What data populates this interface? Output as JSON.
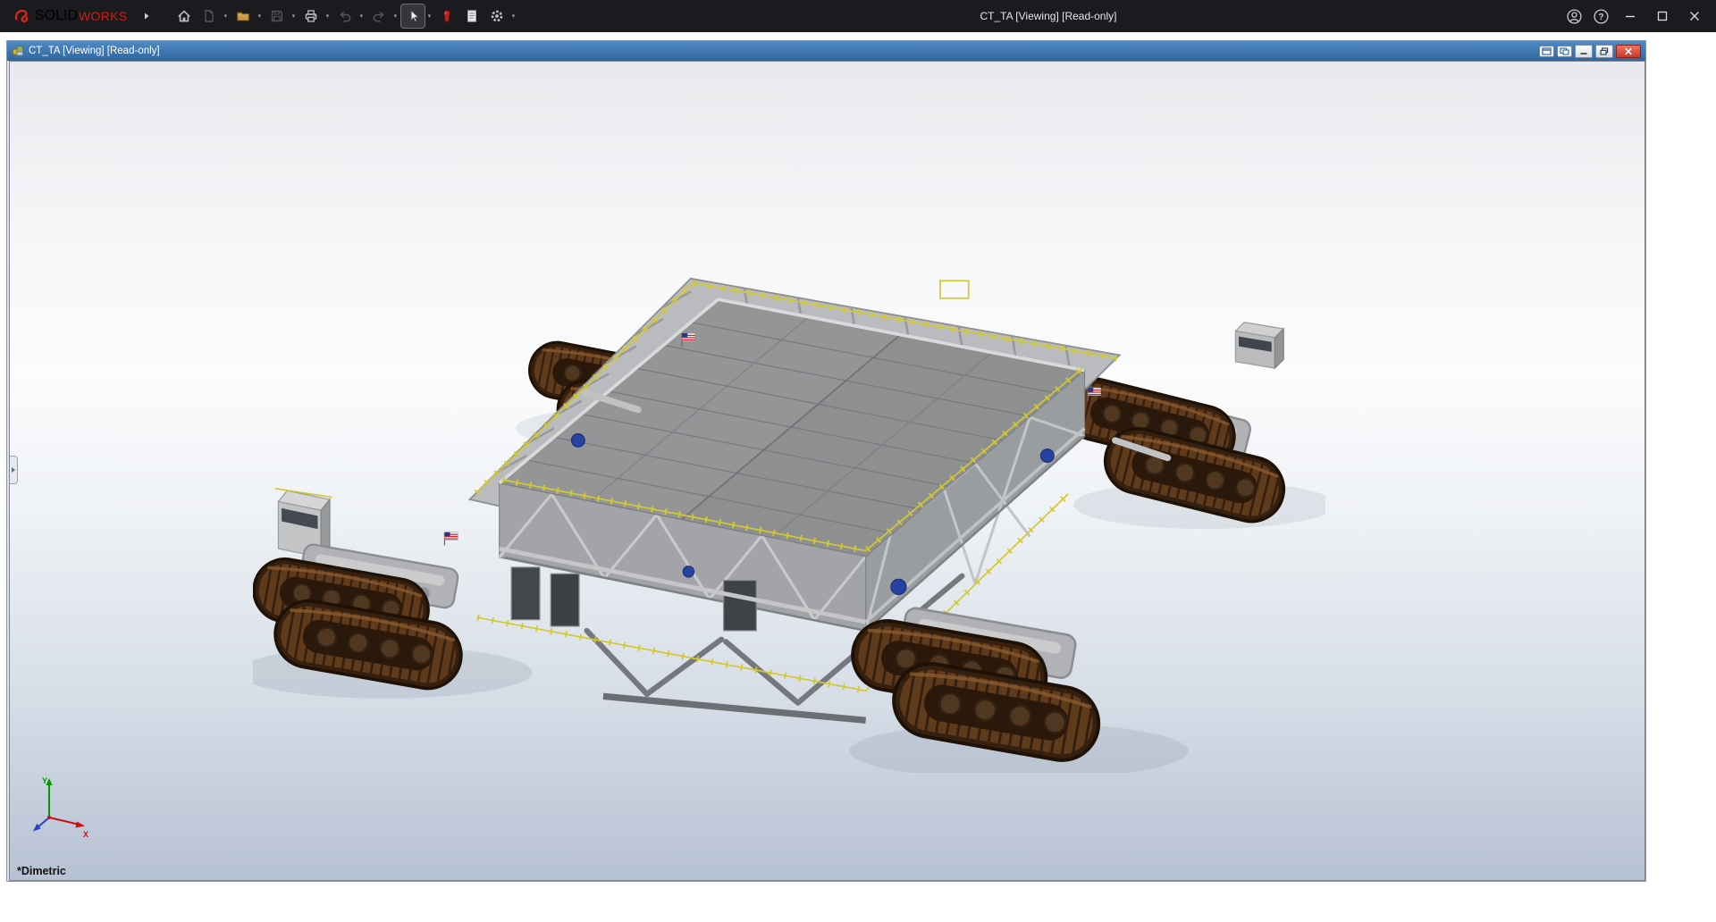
{
  "titlebar": {
    "brand": {
      "bold": "SOLID",
      "light": "WORKS"
    },
    "title": "CT_TA [Viewing] [Read-only]",
    "help_glyph": "?"
  },
  "document": {
    "title": "CT_TA [Viewing] [Read-only]"
  },
  "viewport": {
    "orientation": "*Dimetric",
    "triad": {
      "x": "X",
      "y": "Y"
    }
  },
  "icons": {
    "dassault-logo-icon": "red-swirl",
    "toolbar-expand-icon": "chevron-right",
    "home-icon": "house",
    "new-document-icon": "blank-page (disabled)",
    "open-icon": "yellow-folder",
    "save-icon": "floppy-disk (disabled)",
    "print-icon": "printer",
    "undo-icon": "curved-arrow-left (disabled)",
    "redo-icon": "curved-arrow-right (disabled)",
    "select-cursor-icon": "white-arrow-cursor (active tool)",
    "red-marker-icon": "red-pill",
    "task-pane-icon": "document-with-lines",
    "settings-gear-icon": "gear",
    "account-icon": "person-circle",
    "help-icon": "question-circle",
    "minimize-icon": "dash",
    "maximize-icon": "square",
    "close-icon": "cross",
    "assembly-icon": "yellow-green-blocks",
    "crawler-model": "nasa-crawler-transporter-3d-view"
  },
  "colors": {
    "titlebar_dark": "#1b1b1f",
    "doc_titlebar_blue": "#3a72ae",
    "doc_close_red": "#d64a36",
    "brand_red": "#e2231a",
    "railing_yellow": "#d4c832",
    "track_brown": "#5f3a1b",
    "deck_gray": "#939597",
    "nasa_blue": "#27409f",
    "viewport_bottom": "#b6c1d3"
  }
}
